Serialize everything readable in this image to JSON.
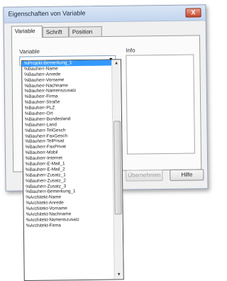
{
  "window": {
    "title": "Eigenschaften von Variable",
    "close_glyph": "X"
  },
  "tabs": [
    {
      "label": "Variable",
      "active": true
    },
    {
      "label": "Schrift",
      "active": false
    },
    {
      "label": "Position",
      "active": false
    }
  ],
  "panel": {
    "variable_label": "Variable",
    "info_label": "Info",
    "combo_arrow": "▼"
  },
  "buttons": {
    "apply_label": "Übernehmen",
    "help_label": "Hilfe"
  },
  "dropdown": {
    "scroll_up_glyph": "▲",
    "scroll_down_glyph": "▼",
    "selected_index": 0,
    "items": [
      "%Projekt-Bemerkung_1",
      "%Bauherr-Name",
      "%Bauherr-Anrede",
      "%Bauherr-Vorname",
      "%Bauherr-Nachname",
      "%Bauherr-Namenszusatz",
      "%Bauherr-Firma",
      "%Bauherr-Straße",
      "%Bauherr-PLZ",
      "%Bauherr-Ort",
      "%Bauherr-Bundesland",
      "%Bauherr-Land",
      "%Bauherr-TelGesch",
      "%Bauherr-FaxGesch",
      "%Bauherr-TelPrivat",
      "%Bauherr-FaxPrivat",
      "%Bauherr-Mobil",
      "%Bauherr-Internet",
      "%Bauherr-E-Mail_1",
      "%Bauherr-E-Mail_2",
      "%Bauherr-Zusatz_1",
      "%Bauherr-Zusatz_2",
      "%Bauherr-Zusatz_3",
      "%Bauherr-Bemerkung_1",
      "%Architekt-Name",
      "%Architekt-Anrede",
      "%Architekt-Vorname",
      "%Architekt-Nachname",
      "%Architekt-Namenszusatz",
      "%Architekt-Firma"
    ]
  }
}
